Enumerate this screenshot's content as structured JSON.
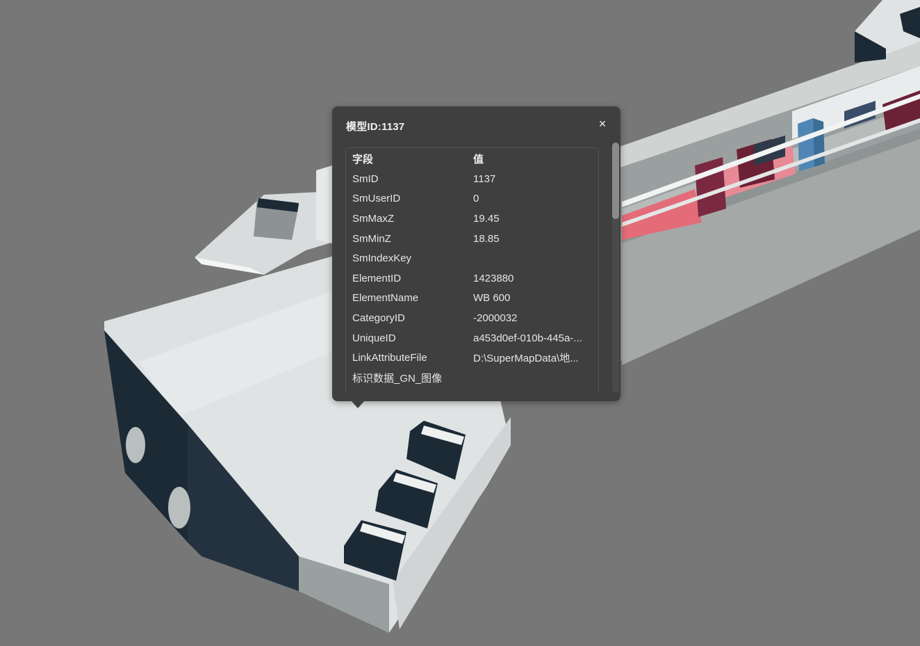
{
  "popup": {
    "title": "模型ID:1137",
    "close_label": "×",
    "headers": {
      "field": "字段",
      "value": "值"
    },
    "rows": [
      {
        "field": "SmID",
        "value": "1137"
      },
      {
        "field": "SmUserID",
        "value": "0"
      },
      {
        "field": "SmMaxZ",
        "value": "19.45"
      },
      {
        "field": "SmMinZ",
        "value": "18.85"
      },
      {
        "field": "SmIndexKey",
        "value": ""
      },
      {
        "field": "ElementID",
        "value": "1423880"
      },
      {
        "field": "ElementName",
        "value": "WB 600"
      },
      {
        "field": "CategoryID",
        "value": "-2000032"
      },
      {
        "field": "UniqueID",
        "value": "a453d0ef-010b-445a-..."
      },
      {
        "field": "LinkAttributeFile",
        "value": "D:\\SuperMapData\\地..."
      },
      {
        "field": "标识数据_GN_图像",
        "value": ""
      }
    ]
  },
  "colors": {
    "background": "#777777",
    "popup_background": "#3f3f3f",
    "model_light": "#dfe3e3",
    "model_dark": "#1c2a36",
    "highlight_pink": "#e46c78",
    "highlight_maroon": "#6b2236",
    "highlight_blue": "#4f86b5"
  }
}
